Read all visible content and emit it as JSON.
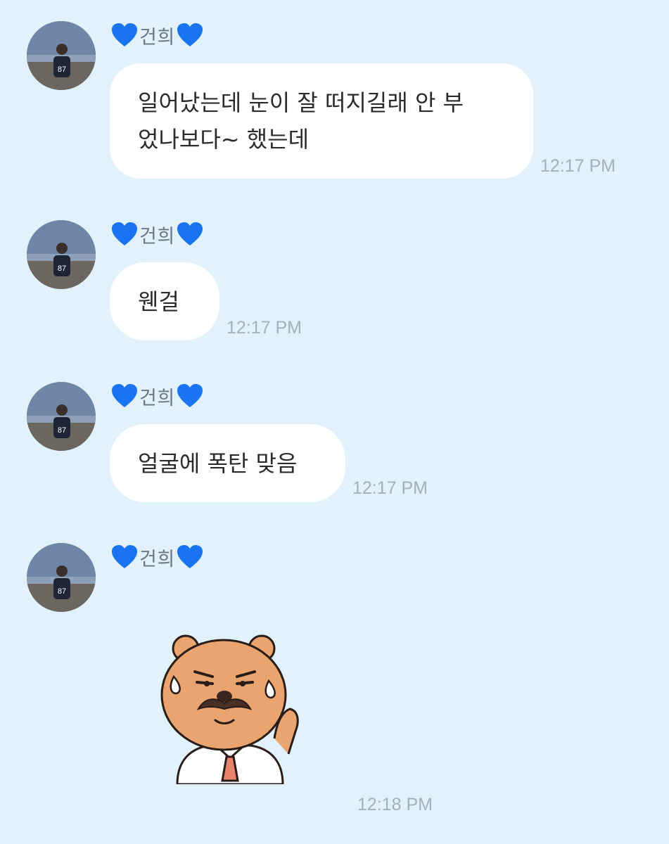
{
  "sender": {
    "name": "건희",
    "heart_icon": "blue-heart-icon",
    "heart_color": "#1a73f0"
  },
  "messages": [
    {
      "type": "text",
      "text": "일어났는데 눈이 잘 떠지길래 안 부\n었나보다~ 했는데",
      "time": "12:17 PM"
    },
    {
      "type": "text",
      "text": "웬걸",
      "time": "12:17 PM"
    },
    {
      "type": "text",
      "text": "얼굴에 폭탄 맞음",
      "time": "12:17 PM"
    },
    {
      "type": "sticker",
      "sticker": "bear-mustache-sweat-sticker",
      "time": "12:18 PM"
    }
  ],
  "colors": {
    "background": "#e1f2fd",
    "bubble": "#ffffff",
    "time_text": "#a4b0bd"
  }
}
